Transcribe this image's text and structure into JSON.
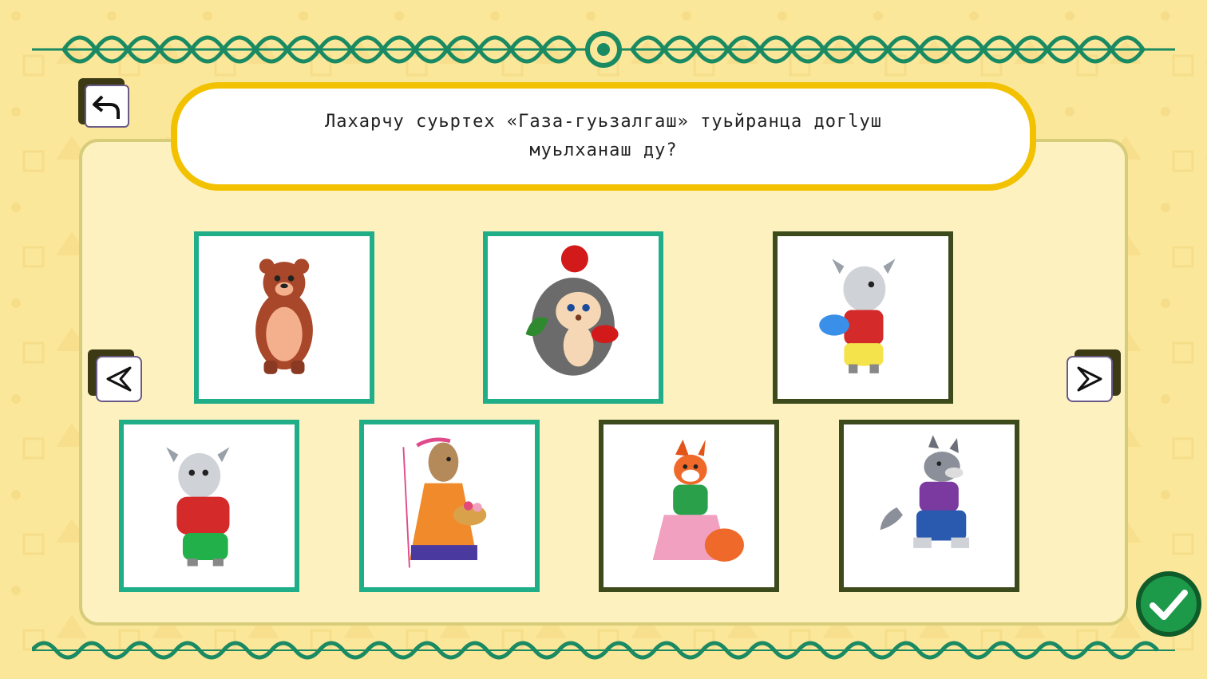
{
  "question": {
    "line1": "Лахарчу суьртех «Газа-гуьзалгаш» туьйранца догlуш",
    "line2": "муьлханаш ду?"
  },
  "cards": [
    {
      "icon": "bear-icon",
      "frame": "teal"
    },
    {
      "icon": "hedgehog-icon",
      "frame": "teal"
    },
    {
      "icon": "goat-kid-blue-shirt-icon",
      "frame": "olive"
    },
    {
      "icon": "goat-kid-red-shirt-icon",
      "frame": "teal"
    },
    {
      "icon": "mother-goat-icon",
      "frame": "teal"
    },
    {
      "icon": "fox-icon",
      "frame": "olive"
    },
    {
      "icon": "wolf-icon",
      "frame": "olive"
    }
  ],
  "colors": {
    "background": "#fbe79a",
    "panel": "#fdf1c0",
    "question_border": "#f2c100",
    "frame_selected": "#1fae88",
    "frame_default": "#3d4a1c",
    "ornament": "#1a8a63",
    "confirm": "#1c9a4a"
  },
  "icons": {
    "back": "back-arrow-icon",
    "prev": "left-arrow-icon",
    "next": "right-arrow-icon",
    "confirm": "checkmark-icon"
  }
}
